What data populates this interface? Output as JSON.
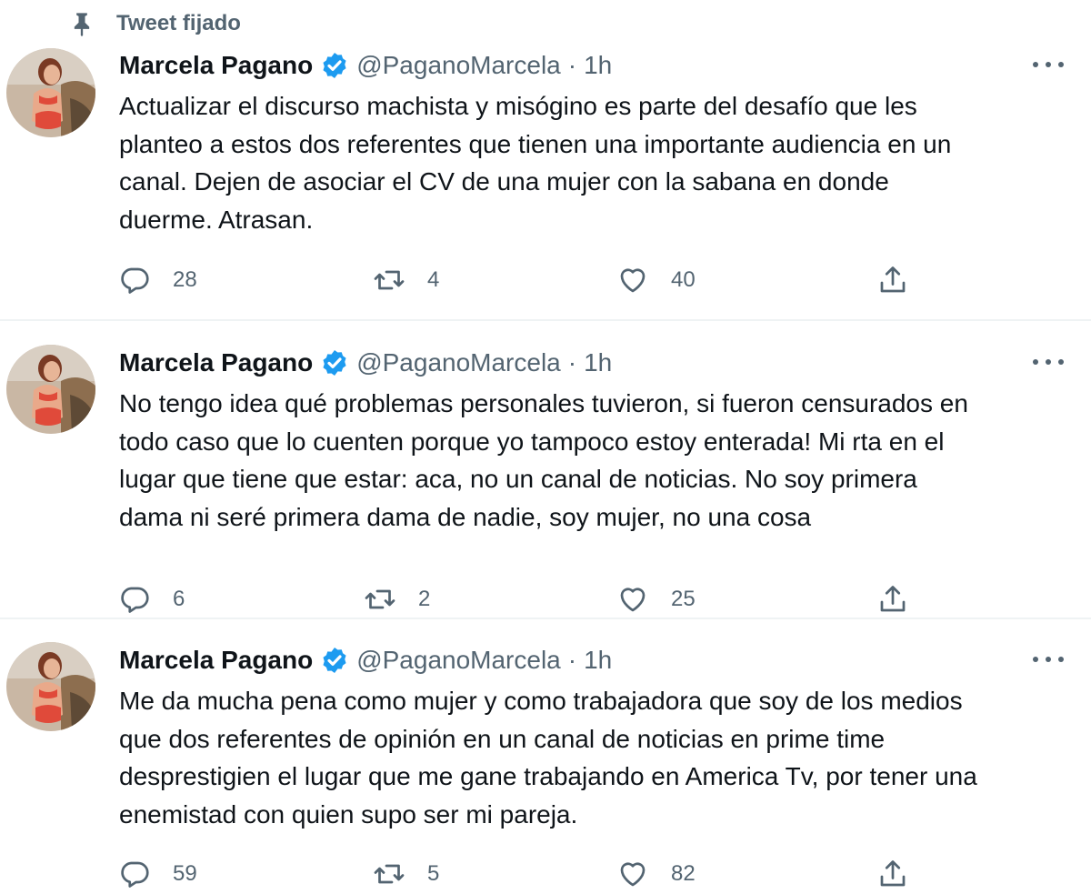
{
  "pinned": {
    "label": "Tweet fijado"
  },
  "colors": {
    "text": "#0f1419",
    "secondary": "#536471",
    "verified": "#1d9bf0",
    "divider": "#eff3f4"
  },
  "tweets": [
    {
      "author": {
        "name": "Marcela Pagano",
        "handle": "@PaganoMarcela",
        "verified": true
      },
      "separator": "·",
      "time": "1h",
      "text": "Actualizar el discurso machista y misógino es parte del desafío que les\nplanteo a estos dos referentes que tienen una importante audiencia en un\ncanal. Dejen de asociar el CV de una mujer con la sabana en donde\nduerme. Atrasan.",
      "replies": "28",
      "retweets": "4",
      "likes": "40"
    },
    {
      "author": {
        "name": "Marcela Pagano",
        "handle": "@PaganoMarcela",
        "verified": true
      },
      "separator": "·",
      "time": "1h",
      "text": "No tengo idea qué problemas personales tuvieron, si fueron censurados en\ntodo caso que lo cuenten porque yo tampoco estoy enterada! Mi rta en el\nlugar que tiene que estar: aca, no un canal de noticias. No soy primera\ndama ni seré primera dama de nadie, soy mujer, no una cosa",
      "replies": "6",
      "retweets": "2",
      "likes": "25"
    },
    {
      "author": {
        "name": "Marcela Pagano",
        "handle": "@PaganoMarcela",
        "verified": true
      },
      "separator": "·",
      "time": "1h",
      "text": "Me da mucha pena como mujer y como trabajadora que soy de los medios\nque dos referentes de opinión en un canal de noticias en prime time\ndesprestigien el lugar que me gane trabajando en America Tv, por tener una\nenemistad con quien supo ser mi pareja.",
      "replies": "59",
      "retweets": "5",
      "likes": "82"
    }
  ]
}
